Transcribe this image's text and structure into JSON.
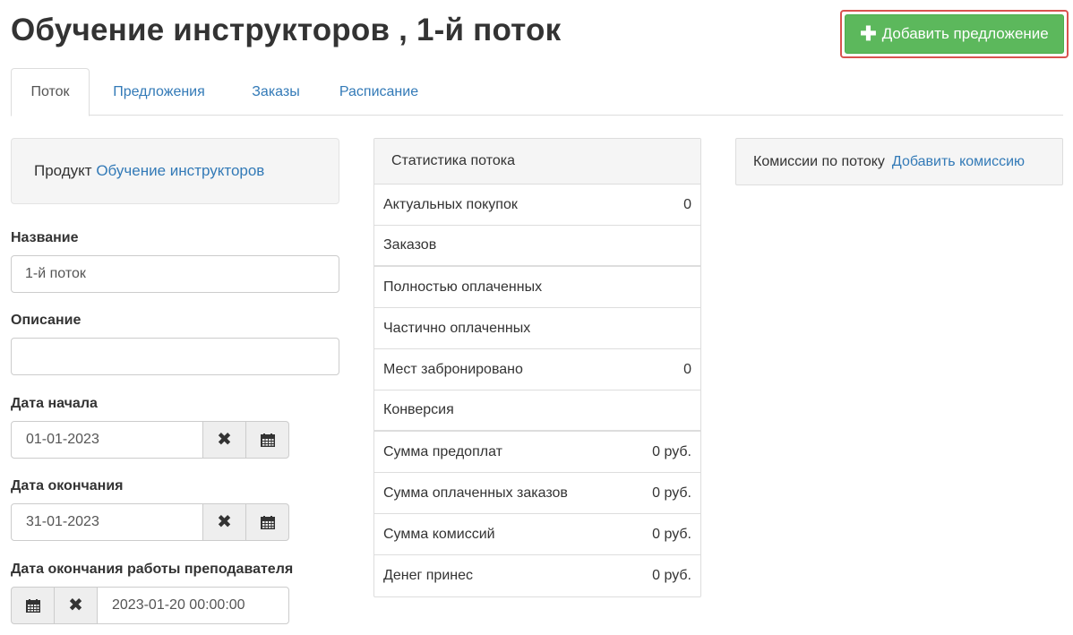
{
  "page": {
    "title": "Обучение инструкторов , 1-й поток",
    "add_offer_label": "Добавить предложение"
  },
  "tabs": [
    {
      "label": "Поток",
      "active": true
    },
    {
      "label": "Предложения",
      "active": false
    },
    {
      "label": "Заказы",
      "active": false
    },
    {
      "label": "Расписание",
      "active": false
    }
  ],
  "product": {
    "prefix": "Продукт",
    "link_label": "Обучение инструкторов"
  },
  "form": {
    "name_label": "Название",
    "name_value": "1-й поток",
    "description_label": "Описание",
    "description_value": "",
    "start_label": "Дата начала",
    "start_value": "01-01-2023",
    "end_label": "Дата окончания",
    "end_value": "31-01-2023",
    "teacher_end_label": "Дата окончания работы преподавателя",
    "teacher_end_value": "2023-01-20 00:00:00",
    "clear_glyph": "✖"
  },
  "stats": {
    "heading": "Статистика потока",
    "rows": [
      {
        "label": "Актуальных покупок",
        "value": "0"
      },
      {
        "label": "Заказов",
        "value": ""
      },
      {
        "label": "Полностью оплаченных",
        "value": ""
      },
      {
        "label": "Частично оплаченных",
        "value": ""
      },
      {
        "label": "Мест забронировано",
        "value": "0"
      },
      {
        "label": "Конверсия",
        "value": ""
      },
      {
        "label": "Сумма предоплат",
        "value": "0 руб."
      },
      {
        "label": "Сумма оплаченных заказов",
        "value": "0 руб."
      },
      {
        "label": "Сумма комиссий",
        "value": "0 руб."
      },
      {
        "label": "Денег принес",
        "value": "0 руб."
      }
    ]
  },
  "commissions": {
    "title": "Комиссии по потоку",
    "add_link": "Добавить комиссию"
  },
  "colors": {
    "accent": "#337ab7",
    "success": "#5cb85c",
    "highlight": "#d9534f"
  },
  "icons": [
    "plus-icon",
    "clear-icon",
    "calendar-icon"
  ]
}
